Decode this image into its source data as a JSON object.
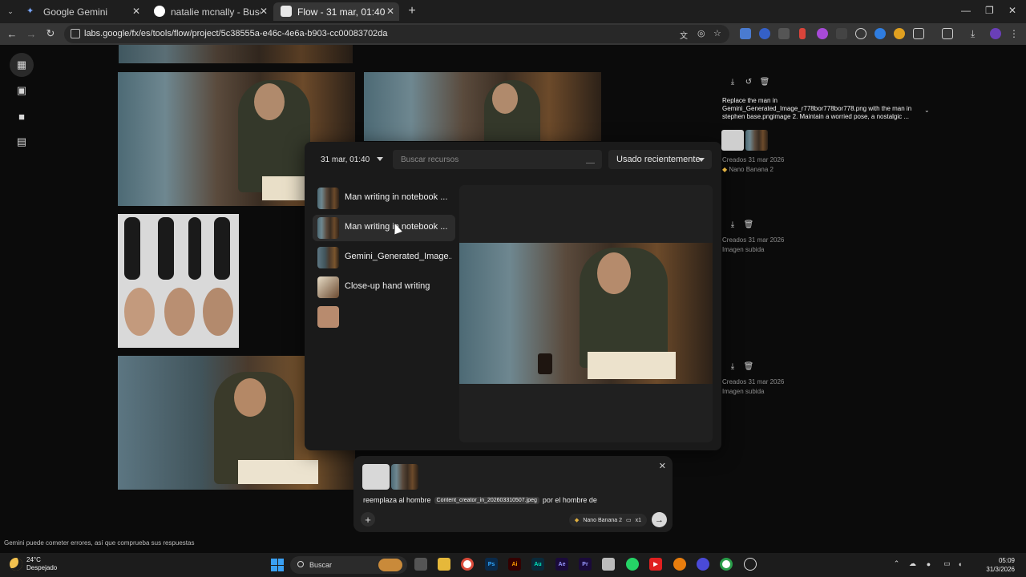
{
  "browser": {
    "tabs": [
      {
        "title": "Google Gemini",
        "active": false
      },
      {
        "title": "natalie mcnally - Buscar con Go",
        "active": false
      },
      {
        "title": "Flow - 31 mar, 01:40",
        "active": true
      }
    ],
    "url": "labs.google/fx/es/tools/flow/project/5c38555a-e46c-4e6a-b903-cc00083702da"
  },
  "left_nav": {
    "items": [
      {
        "icon": "grid-view-icon",
        "active": true
      },
      {
        "icon": "image-icon",
        "active": false
      },
      {
        "icon": "video-icon",
        "active": false
      },
      {
        "icon": "folder-icon",
        "active": false
      }
    ]
  },
  "resource_picker": {
    "date_filter": "31 mar, 01:40",
    "search_placeholder": "Buscar recursos",
    "sort": "Usado recientemente",
    "items": [
      {
        "label": "Man writing in notebook ..."
      },
      {
        "label": "Man writing in notebook ..."
      },
      {
        "label": "Gemini_Generated_Image..."
      },
      {
        "label": "Close-up hand writing"
      },
      {
        "label": ""
      }
    ]
  },
  "right_column": {
    "prompt": "Replace the man in Gemini_Generated_Image_r778bor778bor778.png with the man in stephen base.pngimage 2. Maintain a worried pose, a nostalgic ...",
    "entries": [
      {
        "created": "Creados 31 mar 2026",
        "detail": "Nano Banana 2"
      },
      {
        "created": "Creados 31 mar 2026",
        "detail": "Imagen subida"
      },
      {
        "created": "Creados 31 mar 2026",
        "detail": "Imagen subida"
      }
    ]
  },
  "composer": {
    "text_before": "reemplaza al hombre",
    "chip": "Content_creator_in_202603310507.jpeg",
    "text_after": "por el hombre de",
    "model": "Nano Banana 2",
    "count": "x1"
  },
  "disclaimer": "Gemini puede cometer errores, así que comprueba sus respuestas",
  "taskbar": {
    "weather_temp": "24°C",
    "weather_desc": "Despejado",
    "search_label": "Buscar",
    "time": "05:09",
    "date": "31/3/2026"
  }
}
